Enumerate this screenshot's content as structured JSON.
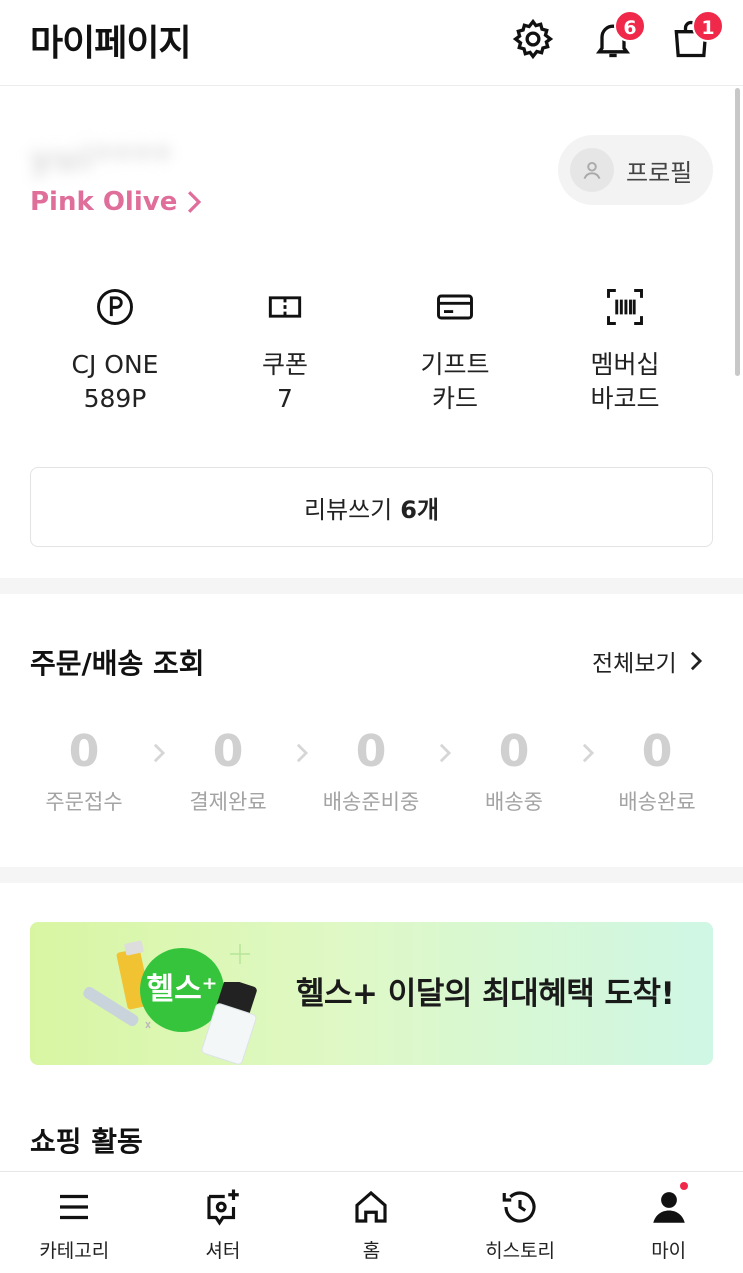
{
  "header": {
    "title": "마이페이지",
    "notification_count": "6",
    "cart_count": "1"
  },
  "profile": {
    "username_blurred": "yui****",
    "grade": "Pink Olive",
    "profile_button": "프로필"
  },
  "quick_menu": [
    {
      "icon": "point-icon",
      "line1": "CJ ONE",
      "line2": "589P"
    },
    {
      "icon": "coupon-icon",
      "line1": "쿠폰",
      "line2": "7"
    },
    {
      "icon": "gift-card-icon",
      "line1": "기프트",
      "line2": "카드"
    },
    {
      "icon": "barcode-icon",
      "line1": "멤버십",
      "line2": "바코드"
    }
  ],
  "review": {
    "label": "리뷰쓰기",
    "count": "6개"
  },
  "orders": {
    "title": "주문/배송 조회",
    "view_all": "전체보기",
    "steps": [
      {
        "count": "0",
        "label": "주문접수"
      },
      {
        "count": "0",
        "label": "결제완료"
      },
      {
        "count": "0",
        "label": "배송준비중"
      },
      {
        "count": "0",
        "label": "배송중"
      },
      {
        "count": "0",
        "label": "배송완료"
      }
    ]
  },
  "banner": {
    "badge": "헬스⁺",
    "text": "헬스+ 이달의 최대혜택 도착!"
  },
  "shopping": {
    "title": "쇼핑 활동"
  },
  "tabbar": [
    {
      "label": "카테고리"
    },
    {
      "label": "셔터"
    },
    {
      "label": "홈"
    },
    {
      "label": "히스토리"
    },
    {
      "label": "마이"
    }
  ],
  "colors": {
    "accent_pink": "#e06e9a",
    "badge_red": "#f0284a",
    "banner_green": "#35c43c"
  }
}
